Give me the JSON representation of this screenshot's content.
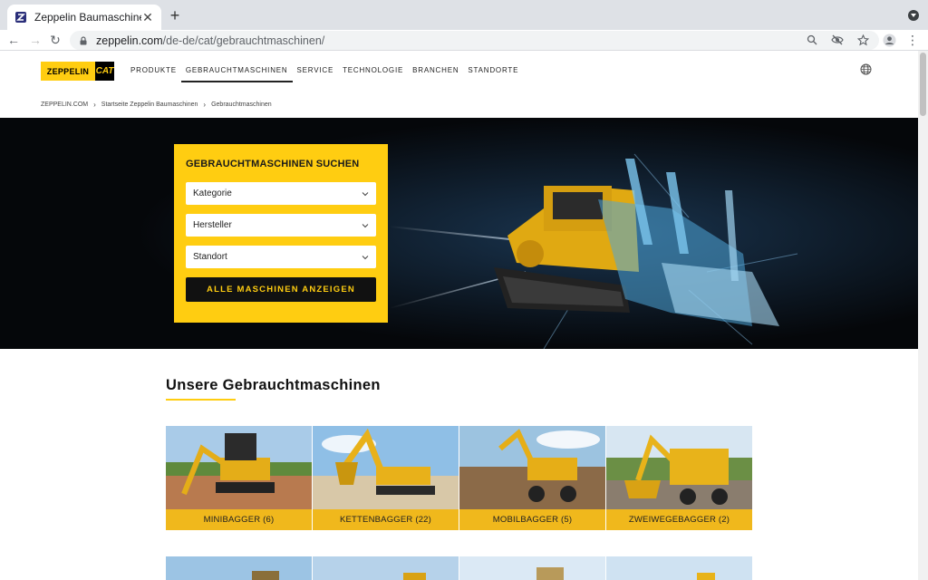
{
  "browser": {
    "tab_title": "Zeppelin Baumaschinen",
    "url_host": "zeppelin.com",
    "url_path": "/de-de/cat/gebrauchtmaschinen/"
  },
  "header": {
    "logo_zeppelin": "ZEPPELIN",
    "logo_cat": "CAT",
    "nav": [
      "PRODUKTE",
      "GEBRAUCHTMASCHINEN",
      "SERVICE",
      "TECHNOLOGIE",
      "BRANCHEN",
      "STANDORTE"
    ]
  },
  "breadcrumb": [
    "ZEPPELIN.COM",
    "Startseite Zeppelin Baumaschinen",
    "Gebrauchtmaschinen"
  ],
  "search": {
    "title": "GEBRAUCHTMASCHINEN SUCHEN",
    "fields": [
      "Kategorie",
      "Hersteller",
      "Standort"
    ],
    "button": "ALLE MASCHINEN ANZEIGEN"
  },
  "section": {
    "title": "Unsere Gebrauchtmaschinen"
  },
  "cards": [
    {
      "label": "MINIBAGGER (6)"
    },
    {
      "label": "KETTENBAGGER (22)"
    },
    {
      "label": "MOBILBAGGER (5)"
    },
    {
      "label": "ZWEIWEGEBAGGER (2)"
    }
  ],
  "colors": {
    "brand_yellow": "#ffcd11",
    "card_label": "#f0b81c",
    "hero_bg": "#05070a"
  }
}
